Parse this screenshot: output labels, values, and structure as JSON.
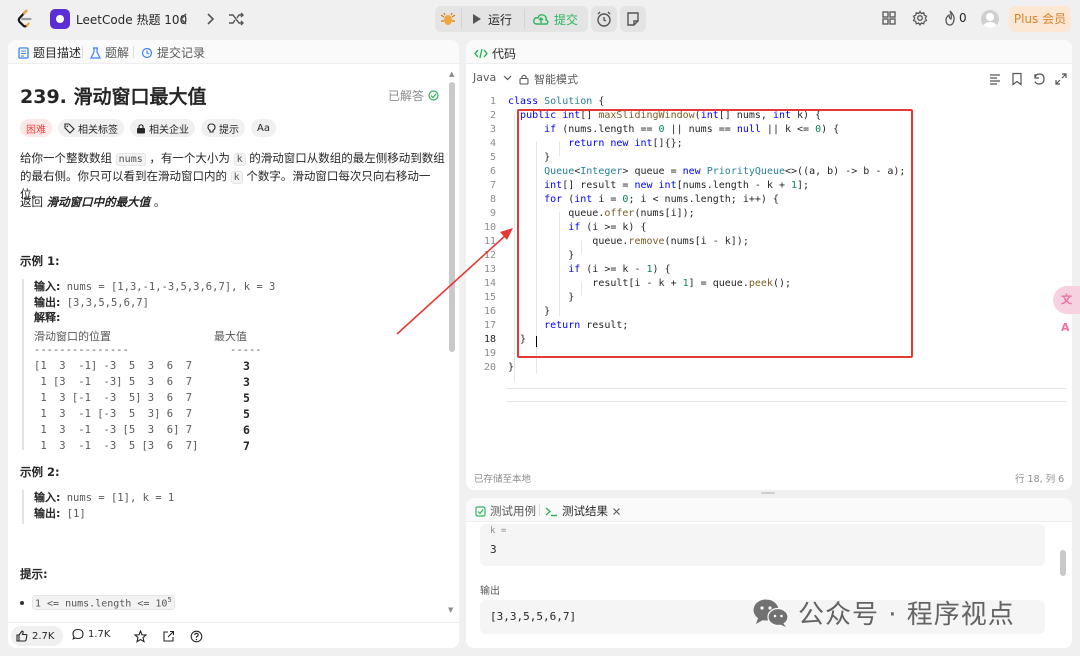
{
  "topbar": {
    "study_title": "LeetCode 热题 100",
    "run_label": "运行",
    "submit_label": "提交",
    "fire_count": "0",
    "plus_label": "Plus 会员"
  },
  "left_tabs": {
    "description": "题目描述",
    "solutions": "题解",
    "submissions": "提交记录"
  },
  "problem": {
    "title": "239. 滑动窗口最大值",
    "status": "已解答",
    "tags": [
      "困难",
      "相关标签",
      "相关企业",
      "提示",
      "Aa"
    ],
    "desc_part1": "给你一个整数数组",
    "desc_code1": "nums",
    "desc_part2": "，有一个大小为",
    "desc_code2": "k",
    "desc_part3": "的滑动窗口从数组的最左侧移动到数组的最右侧。你只可以看到在滑动窗口内的",
    "desc_code3": "k",
    "desc_part4": "个数字。滑动窗口每次只向右移动一位。",
    "return_prefix": "返回",
    "return_em": "滑动窗口中的最大值",
    "return_suffix": "。"
  },
  "example1": {
    "title": "示例 1:",
    "input_label": "输入:",
    "input_value": " nums = [1,3,-1,-3,5,3,6,7], k = 3",
    "output_label": "输出:",
    "output_value": " [3,3,5,5,6,7]",
    "explain_label": "解释:",
    "col_position": "滑动窗口的位置",
    "col_max": "最大值",
    "dash_left": "---------------",
    "dash_right": "-----",
    "windows": [
      "[1  3  -1] -3  5  3  6  7",
      " 1 [3  -1  -3] 5  3  6  7",
      " 1  3 [-1  -3  5] 3  6  7",
      " 1  3  -1 [-3  5  3] 6  7",
      " 1  3  -1  -3 [5  3  6] 7",
      " 1  3  -1  -3  5 [3  6  7]"
    ],
    "maxes": [
      "3",
      "3",
      "5",
      "5",
      "6",
      "7"
    ]
  },
  "example2": {
    "title": "示例 2:",
    "input_label": "输入:",
    "input_value": " nums = [1], k = 1",
    "output_label": "输出:",
    "output_value": " [1]"
  },
  "hints": {
    "title": "提示:",
    "constraint_prefix": "1 <= nums.length <= 10",
    "constraint_sup": "5"
  },
  "footer": {
    "likes": "2.7K",
    "comments": "1.7K"
  },
  "editor": {
    "tab_label": "代码",
    "language": "Java",
    "mode": "智能模式",
    "saved_status": "已存储至本地",
    "cursor_pos": "行 18, 列 6",
    "line_numbers": [
      "1",
      "2",
      "3",
      "4",
      "5",
      "6",
      "7",
      "8",
      "9",
      "10",
      "11",
      "12",
      "13",
      "14",
      "15",
      "16",
      "17",
      "18",
      "19",
      "20"
    ],
    "code": {
      "l1_kw": "class",
      "l1_cls": "Solution",
      "l1_rest": " {",
      "l2_kw": "public",
      "l2_ty": "int",
      "l2_mid": "[] ",
      "l2_fn": "maxSlidingWindow",
      "l2_p1": "(",
      "l2_ty2": "int",
      "l2_p2": "[] nums, ",
      "l2_ty3": "int",
      "l2_p3": " k) {",
      "l3_kw": "if",
      "l3_a": " (nums.length == ",
      "l3_n0": "0",
      "l3_b": " || nums == ",
      "l3_kw2": "null",
      "l3_c": " || k <= ",
      "l3_n1": "0",
      "l3_d": ") {",
      "l4_kw": "return",
      "l4_kw2": "new",
      "l4_ty": "int",
      "l4_rest": "[]{};",
      "l5": "}",
      "l6_ty": "Queue",
      "l6_a": "<",
      "l6_ty2": "Integer",
      "l6_b": "> queue = ",
      "l6_kw": "new",
      "l6_ty3": "PriorityQueue",
      "l6_c": "<>((a, b) -> b - a);",
      "l7_ty": "int",
      "l7_a": "[] result = ",
      "l7_kw": "new",
      "l7_ty2": "int",
      "l7_b": "[nums.length - k + ",
      "l7_n": "1",
      "l7_c": "];",
      "l8_kw": "for",
      "l8_a": " (",
      "l8_ty": "int",
      "l8_b": " i = ",
      "l8_n": "0",
      "l8_c": "; i < nums.length; i++) {",
      "l9_a": "queue.",
      "l9_fn": "offer",
      "l9_b": "(nums[i]);",
      "l10_kw": "if",
      "l10_a": " (i >= k) {",
      "l11_a": "queue.",
      "l11_fn": "remove",
      "l11_b": "(nums[i - k]);",
      "l12": "}",
      "l13_kw": "if",
      "l13_a": " (i >= k - ",
      "l13_n": "1",
      "l13_b": ") {",
      "l14_a": "result[i - k + ",
      "l14_n": "1",
      "l14_b": "] = queue.",
      "l14_fn": "peek",
      "l14_c": "();",
      "l15": "}",
      "l16": "}",
      "l17_kw": "return",
      "l17_a": " result;",
      "l18": "}",
      "l19": "",
      "l20": "}"
    }
  },
  "result": {
    "tab_testcase": "测试用例",
    "tab_result": "测试结果",
    "k_label": "k =",
    "k_value": "3",
    "output_label": "输出",
    "output_value": "[3,3,5,5,6,7]"
  },
  "overlay": {
    "translate_badge": "文A",
    "watermark_text": "公众号 · 程序视点"
  },
  "colors": {
    "hard_tag": "#ef4743",
    "submit_green": "#2db55d",
    "plus_orange": "#d9822b",
    "annotation_red": "#e53935"
  }
}
